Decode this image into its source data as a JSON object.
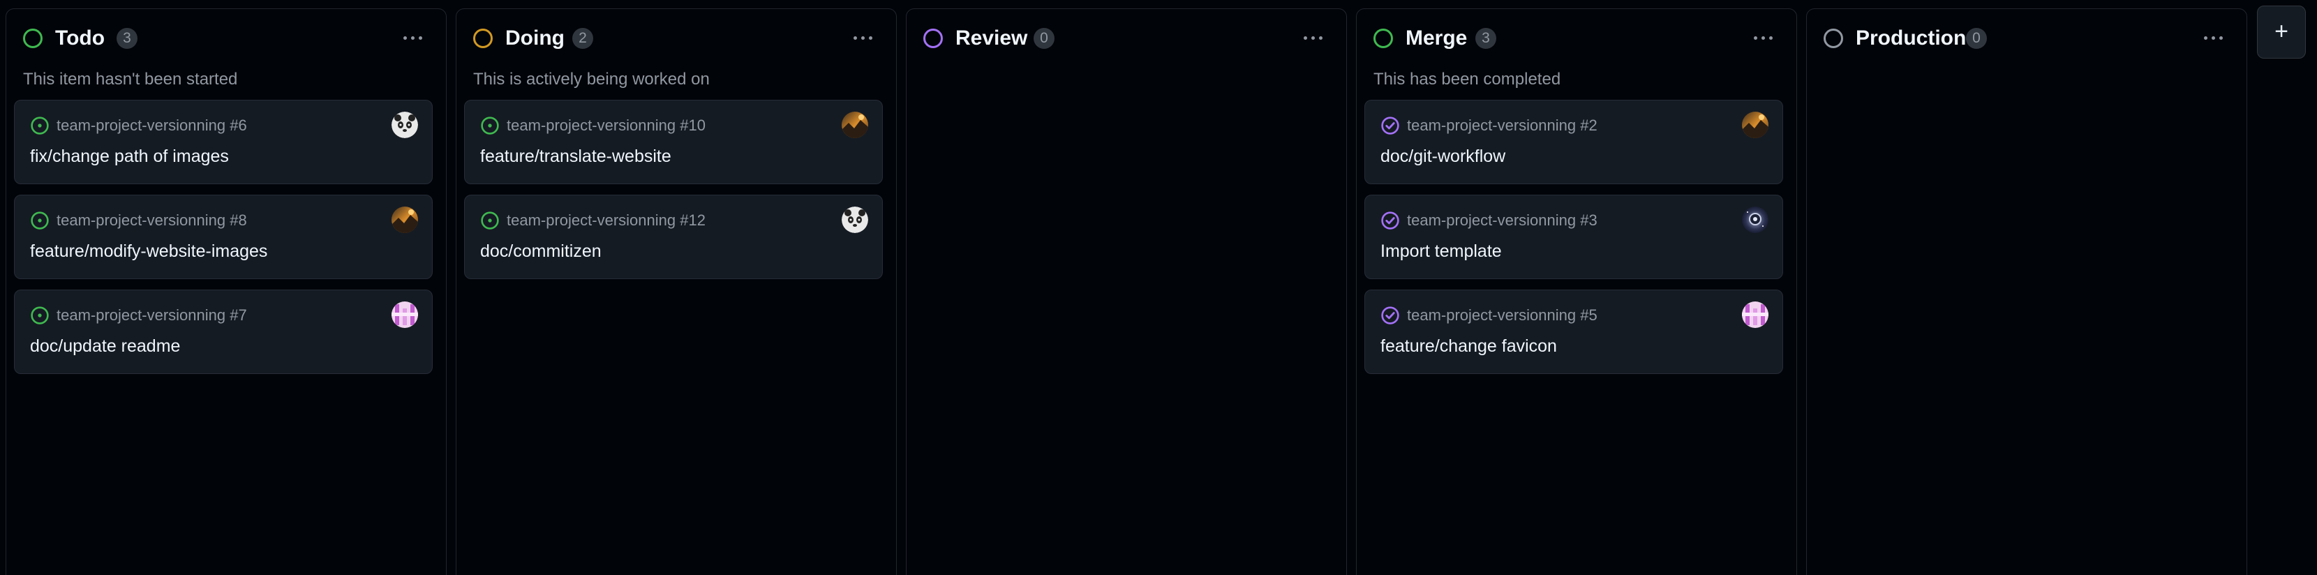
{
  "columns": [
    {
      "title": "Todo",
      "count": "3",
      "status_color": "#3fb950",
      "description": "This item hasn't been started",
      "cards": [
        {
          "repo": "team-project-versionning #6",
          "title": "fix/change path of images",
          "state": "open",
          "avatar": "panda-avatar"
        },
        {
          "repo": "team-project-versionning #8",
          "title": "feature/modify-website-images",
          "state": "open",
          "avatar": "landscape-avatar"
        },
        {
          "repo": "team-project-versionning #7",
          "title": "doc/update readme",
          "state": "open",
          "avatar": "pink-pattern-avatar"
        }
      ]
    },
    {
      "title": "Doing",
      "count": "2",
      "status_color": "#d29922",
      "description": "This is actively being worked on",
      "cards": [
        {
          "repo": "team-project-versionning #10",
          "title": "feature/translate-website",
          "state": "open",
          "avatar": "landscape-avatar"
        },
        {
          "repo": "team-project-versionning #12",
          "title": "doc/commitizen",
          "state": "open",
          "avatar": "panda-avatar"
        }
      ]
    },
    {
      "title": "Review",
      "count": "0",
      "status_color": "#a371f7",
      "description": "",
      "cards": []
    },
    {
      "title": "Merge",
      "count": "3",
      "status_color": "#3fb950",
      "description": "This has been completed",
      "cards": [
        {
          "repo": "team-project-versionning #2",
          "title": "doc/git-workflow",
          "state": "merged",
          "avatar": "landscape-avatar"
        },
        {
          "repo": "team-project-versionning #3",
          "title": "Import template",
          "state": "merged",
          "avatar": "space-avatar"
        },
        {
          "repo": "team-project-versionning #5",
          "title": "feature/change favicon",
          "state": "merged",
          "avatar": "pink-pattern-avatar"
        }
      ]
    },
    {
      "title": "Production",
      "count": "0",
      "status_color": "#9198a1",
      "description": "",
      "cards": []
    }
  ],
  "colors": {
    "open": "#3fb950",
    "merged": "#a371f7"
  },
  "add_column_label": "+"
}
